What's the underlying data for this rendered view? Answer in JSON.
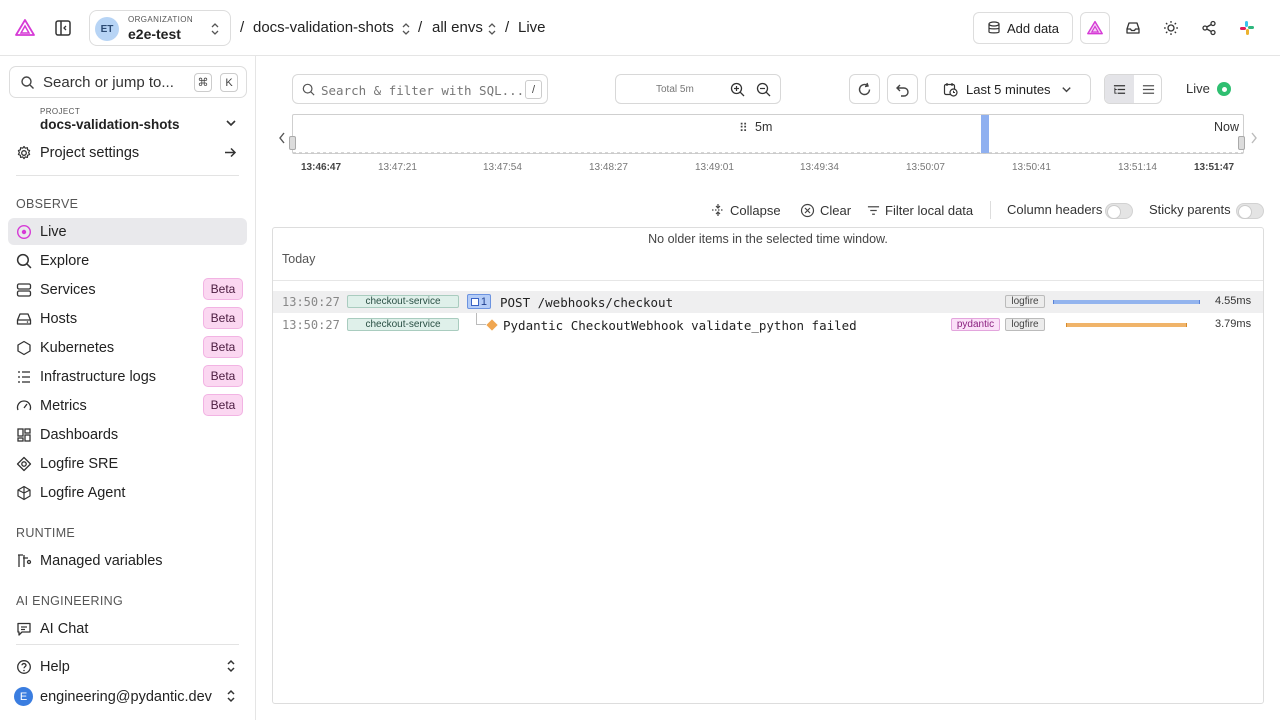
{
  "topbar": {
    "org_label": "ORGANIZATION",
    "org_name": "e2e-test",
    "org_initials": "ET",
    "project_crumb": "docs-validation-shots",
    "env_crumb": "all envs",
    "page_crumb": "Live",
    "separator": "/",
    "add_data_label": "Add data"
  },
  "sidebar": {
    "search_placeholder": "Search or jump to...",
    "kbd_cmd": "⌘",
    "kbd_k": "K",
    "project_label": "PROJECT",
    "project_name": "docs-validation-shots",
    "project_settings": "Project settings",
    "observe_heading": "OBSERVE",
    "runtime_heading": "RUNTIME",
    "ai_heading": "AI ENGINEERING",
    "beta_label": "Beta",
    "items": [
      {
        "label": "Live"
      },
      {
        "label": "Explore"
      },
      {
        "label": "Services"
      },
      {
        "label": "Hosts"
      },
      {
        "label": "Kubernetes"
      },
      {
        "label": "Infrastructure logs"
      },
      {
        "label": "Metrics"
      },
      {
        "label": "Dashboards"
      },
      {
        "label": "Logfire SRE"
      },
      {
        "label": "Logfire Agent"
      },
      {
        "label": "Managed variables"
      },
      {
        "label": "AI Chat"
      }
    ],
    "help_label": "Help",
    "user_email": "engineering@pydantic.dev",
    "user_initial": "E"
  },
  "toolbar": {
    "filter_placeholder": "Search & filter with SQL...",
    "filter_kbd": "/",
    "total_label": "Total 5m",
    "time_range": "Last 5 minutes",
    "live_label": "Live"
  },
  "timeline": {
    "window_label": "5m",
    "now_label": "Now",
    "ticks": [
      "13:46:47",
      "13:47:21",
      "13:47:54",
      "13:48:27",
      "13:49:01",
      "13:49:34",
      "13:50:07",
      "13:50:41",
      "13:51:14",
      "13:51:47"
    ]
  },
  "actions": {
    "collapse": "Collapse",
    "clear": "Clear",
    "filter_local": "Filter local data",
    "column_headers": "Column headers",
    "sticky_parents": "Sticky parents"
  },
  "results": {
    "no_older": "No older items in the selected time window.",
    "day_label": "Today",
    "rows": [
      {
        "time": "13:50:27",
        "service": "checkout-service",
        "badge": "1",
        "message": "POST /webhooks/checkout",
        "tags": [
          "logfire"
        ],
        "duration": "4.55ms"
      },
      {
        "time": "13:50:27",
        "service": "checkout-service",
        "message": "Pydantic CheckoutWebhook validate_python failed",
        "tags": [
          "pydantic",
          "logfire"
        ],
        "duration": "3.79ms"
      }
    ]
  },
  "colors": {
    "accent": "#e620e9",
    "live_dot": "#2fbf71",
    "span_bar_blue": "#93b4ee",
    "span_bar_orange": "#f0b46a",
    "selection": "#8fb0f0"
  }
}
